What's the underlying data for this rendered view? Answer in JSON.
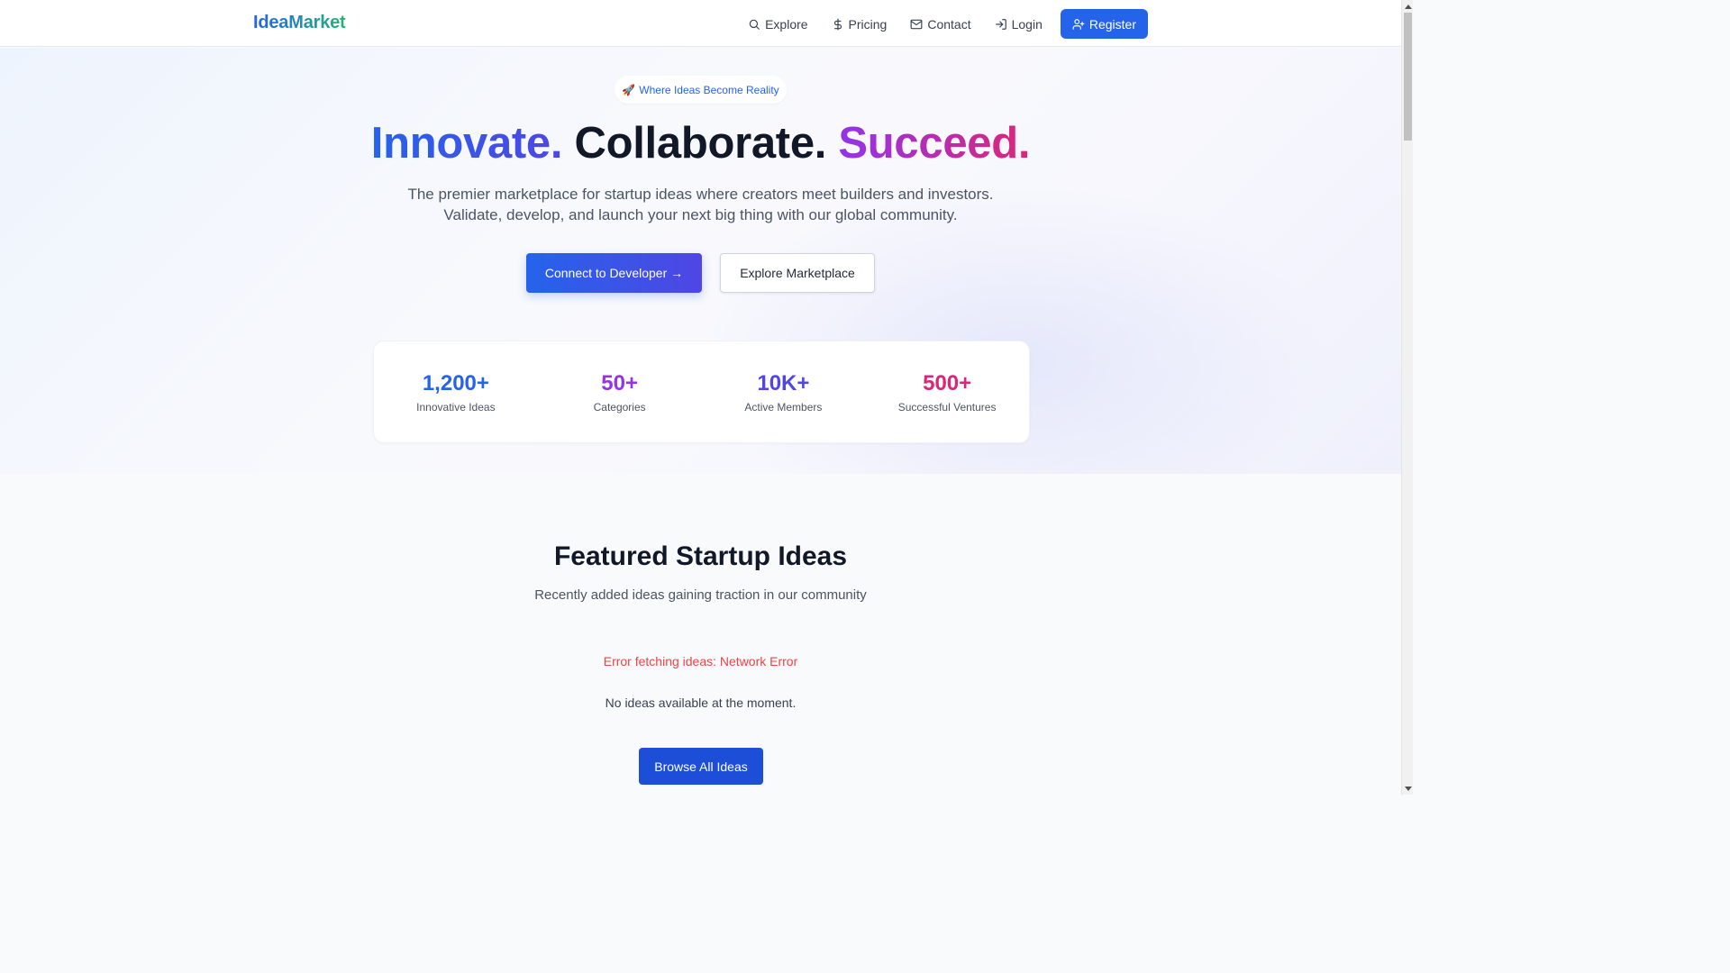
{
  "nav": {
    "brand_part1": "Idea",
    "brand_part2": "Market",
    "links": [
      {
        "label": "Explore",
        "icon": "search-icon"
      },
      {
        "label": "Pricing",
        "icon": "dollar-icon"
      },
      {
        "label": "Contact",
        "icon": "mail-icon"
      },
      {
        "label": "Login",
        "icon": "login-icon"
      }
    ],
    "register_label": "Register",
    "register_icon": "user-plus-icon"
  },
  "hero": {
    "badge_emoji": "🚀",
    "badge_text": "Where Ideas Become Reality",
    "headline_word1": "Innovate.",
    "headline_word2": "Collaborate.",
    "headline_word3": "Succeed.",
    "subtitle_line1": "The premier marketplace for startup ideas where creators meet builders and investors.",
    "subtitle_line2": "Validate, develop, and launch your next big thing with our global community.",
    "primary_cta": "Connect to Developer →",
    "secondary_cta": "Explore Marketplace"
  },
  "stats": [
    {
      "value": "1,200+",
      "label": "Innovative Ideas",
      "color": "#2563eb"
    },
    {
      "value": "50+",
      "label": "Categories",
      "color": "#9333ea"
    },
    {
      "value": "10K+",
      "label": "Active Members",
      "color": "#4f46e5"
    },
    {
      "value": "500+",
      "label": "Successful Ventures",
      "color": "#db2777"
    }
  ],
  "featured": {
    "title": "Featured Startup Ideas",
    "subtitle": "Recently added ideas gaining traction in our community",
    "error": "Error fetching ideas: Network Error",
    "empty": "No ideas available at the moment.",
    "browse_label": "Browse All Ideas"
  },
  "colors": {
    "primary": "#2563eb",
    "accent_green": "#10b981",
    "error": "#ef4444"
  }
}
